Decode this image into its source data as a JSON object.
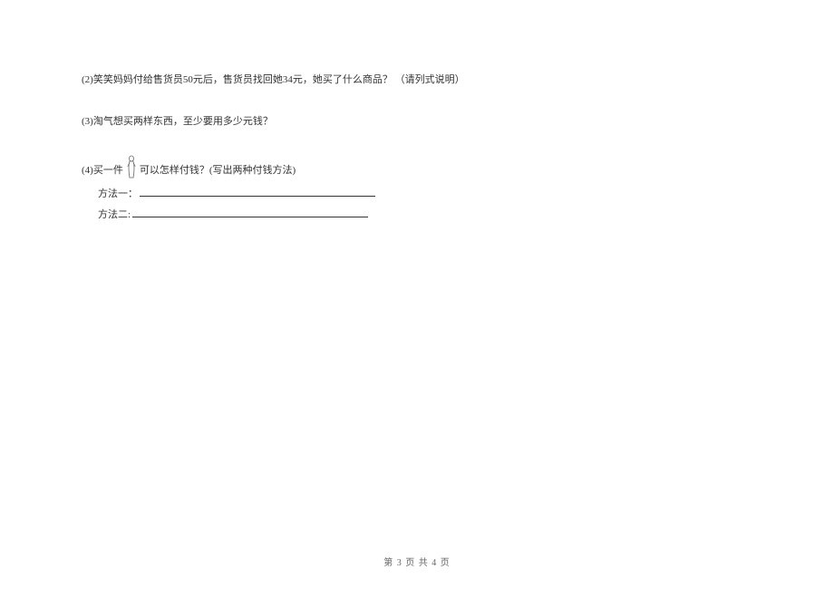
{
  "questions": {
    "q2": "(2)笑笑妈妈付给售货员50元后，售货员找回她34元，她买了什么商品？ （请列式说明）",
    "q3": "(3)淘气想买两样东西，至少要用多少元钱？",
    "q4_prefix": "(4)买一件",
    "q4_suffix": "可以怎样付钱？(写出两种付钱方法)",
    "method1_label": "方法一：",
    "method2_label": "方法二:"
  },
  "footer": {
    "text": "第 3 页 共 4 页"
  },
  "icon": {
    "name": "clothing-item"
  }
}
